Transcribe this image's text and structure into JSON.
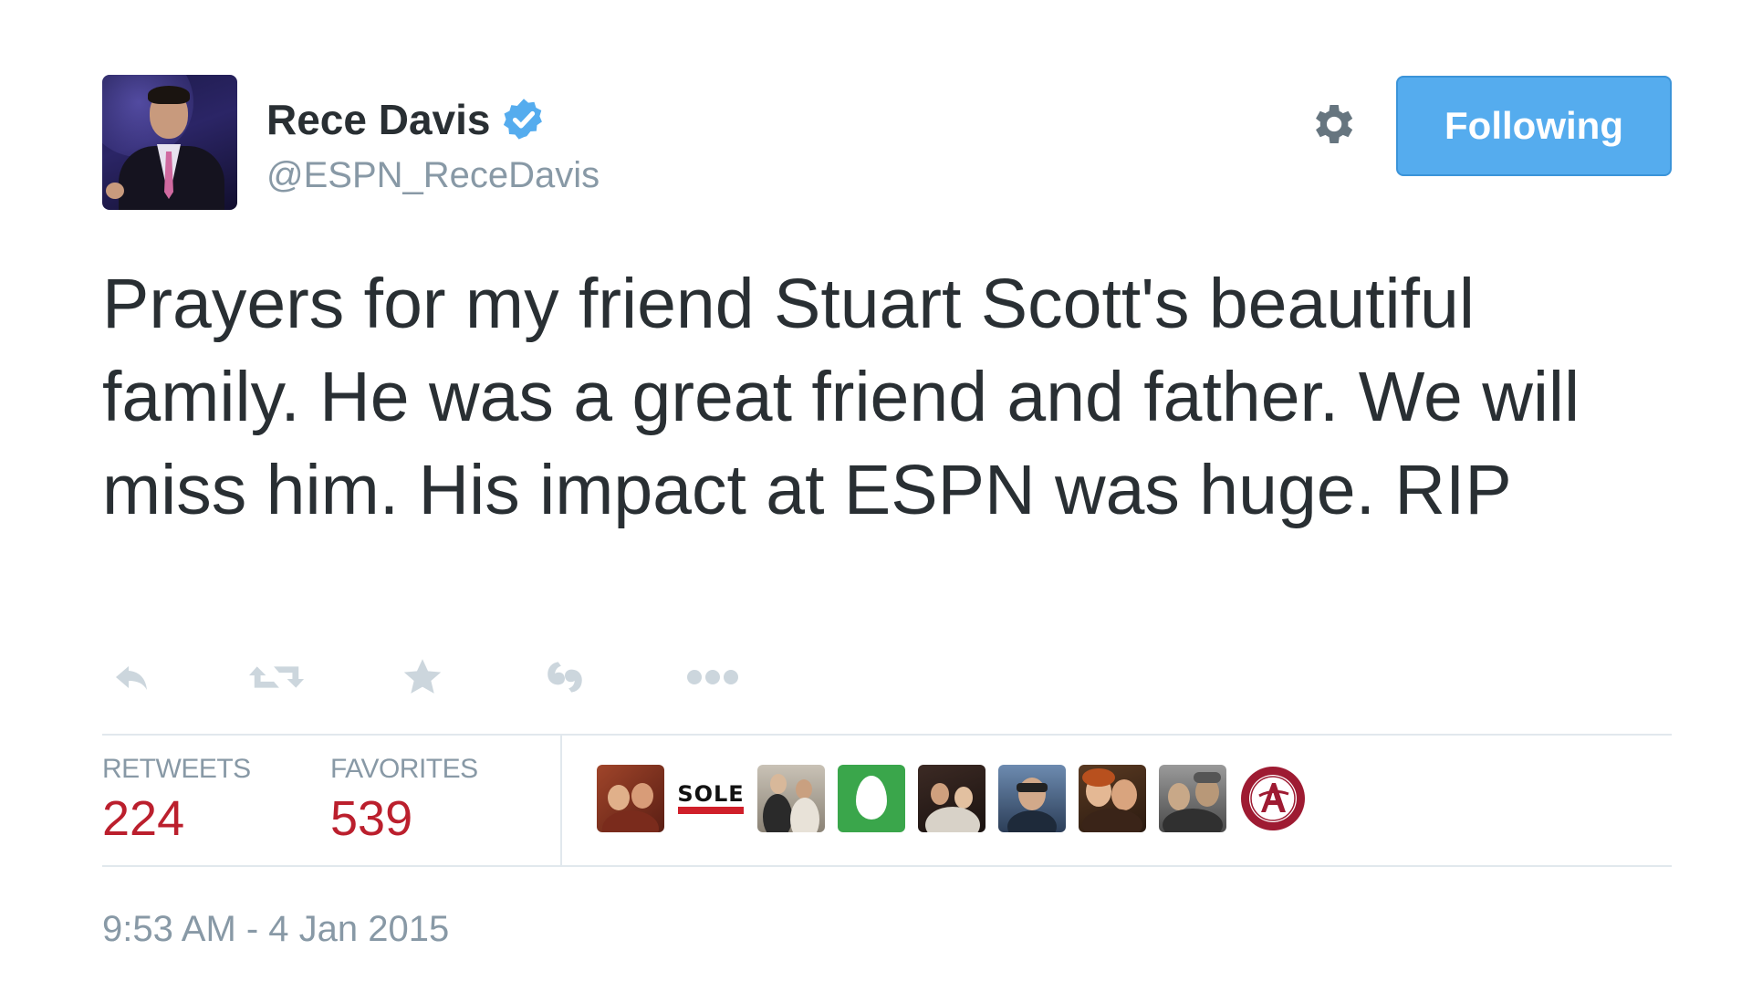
{
  "user": {
    "display_name": "Rece Davis",
    "handle": "@ESPN_ReceDavis",
    "verified_icon": "verified-badge-icon",
    "avatar_icon": "profile-photo"
  },
  "header": {
    "settings_icon": "gear-icon",
    "follow_button_label": "Following"
  },
  "tweet": {
    "text": "Prayers for my friend Stuart Scott's beautiful family. He was a great friend and father. We will miss him. His impact at ESPN was huge. RIP"
  },
  "actions": [
    {
      "icon": "reply-icon"
    },
    {
      "icon": "retweet-icon"
    },
    {
      "icon": "favorite-star-icon"
    },
    {
      "icon": "embed-icon"
    },
    {
      "icon": "more-icon"
    }
  ],
  "stats": {
    "retweets_label": "RETWEETS",
    "retweets_value": "224",
    "favorites_label": "FAVORITES",
    "favorites_value": "539"
  },
  "favoriters": {
    "count": 9,
    "sole_logo_text": "SOLE"
  },
  "timestamp": "9:53 AM - 4 Jan 2015",
  "colors": {
    "follow_button": "#55acee",
    "verified": "#55acee",
    "stat_value": "#bb1f2d",
    "muted_text": "#8899a6",
    "body_text": "#292f33"
  }
}
